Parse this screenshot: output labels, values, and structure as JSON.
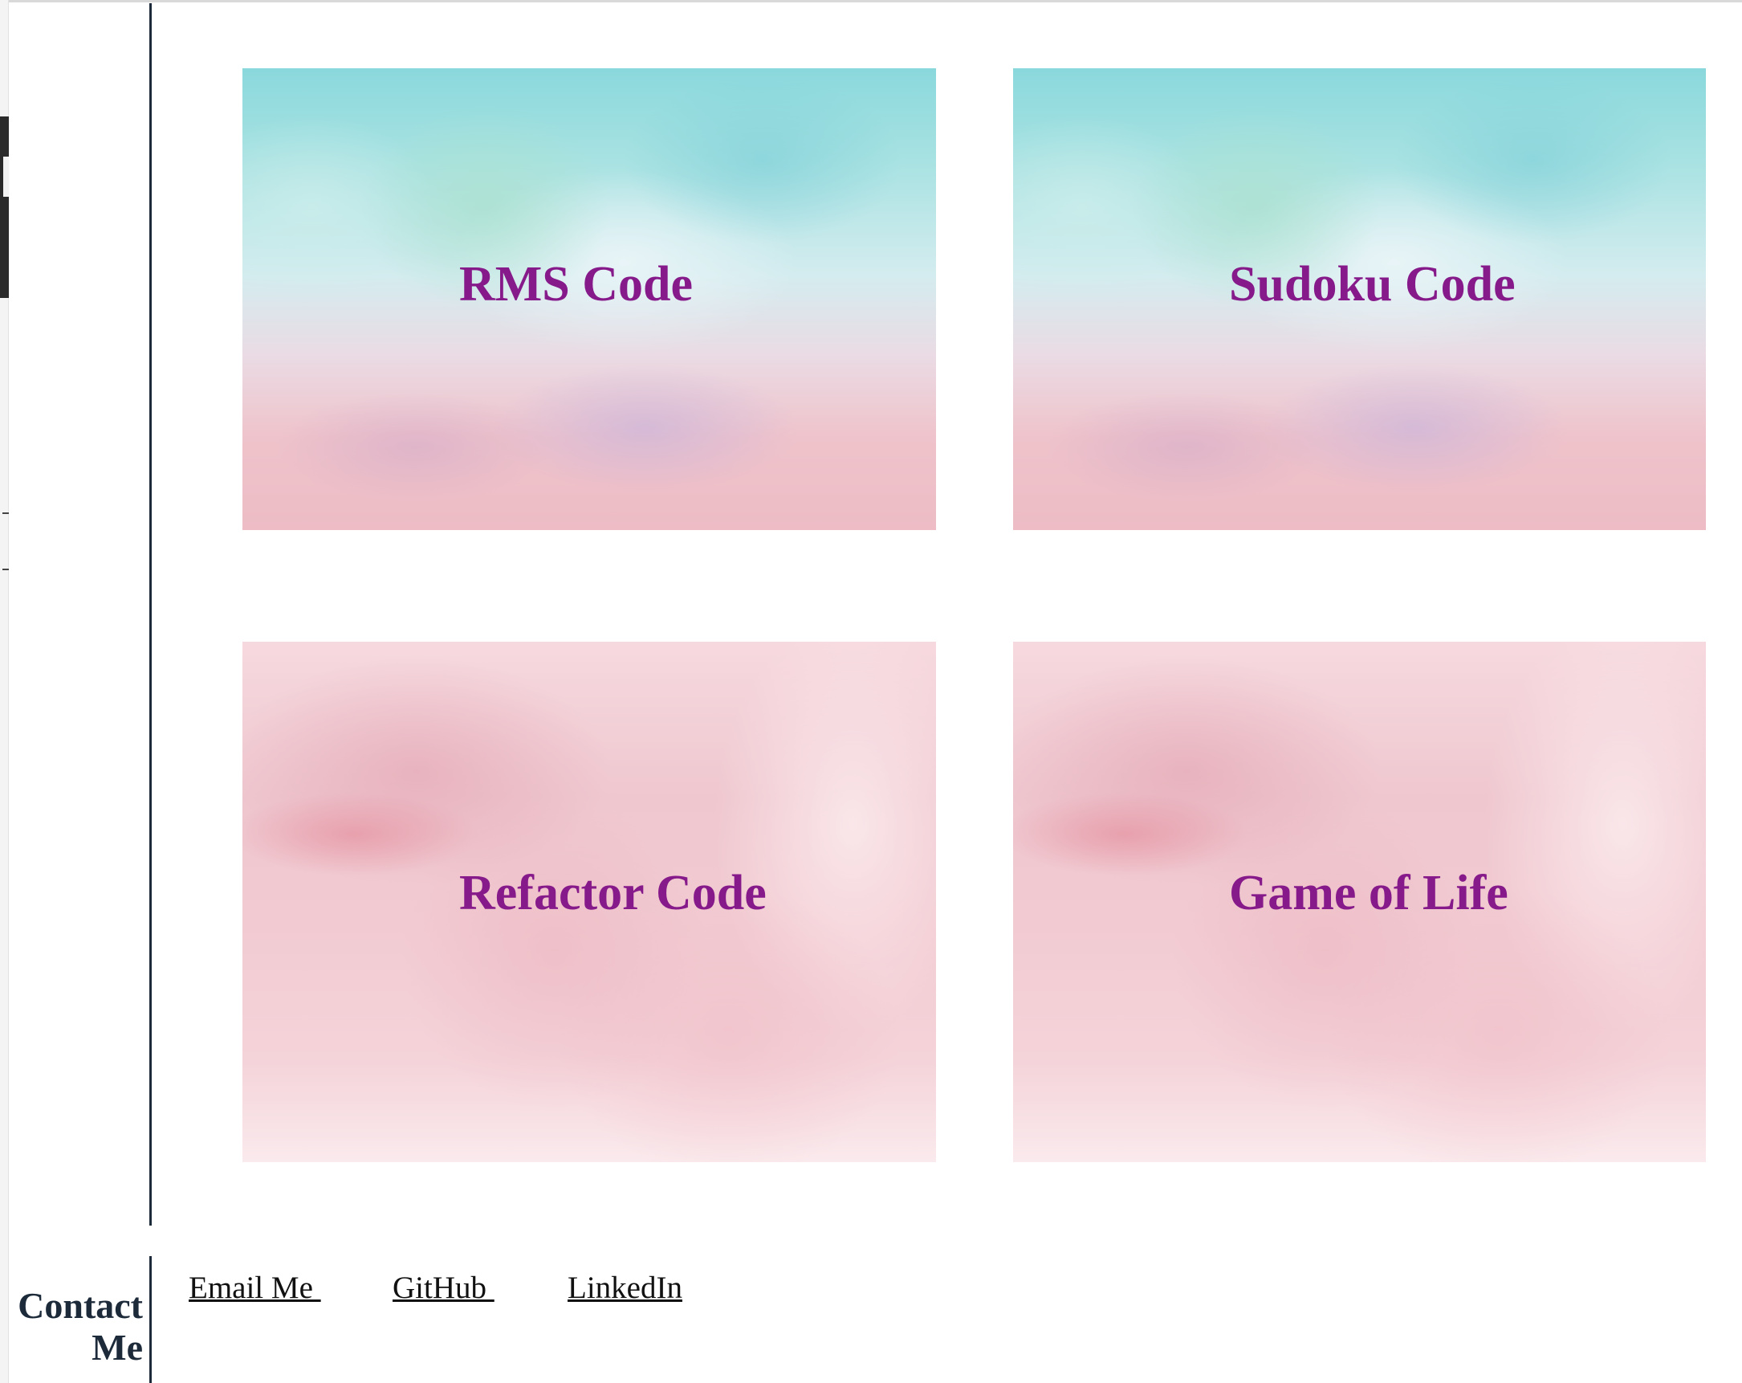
{
  "projects": [
    {
      "label": "RMS Code",
      "theme": "sky"
    },
    {
      "label": "Sudoku Code",
      "theme": "sky"
    },
    {
      "label": "Refactor Code",
      "theme": "pink"
    },
    {
      "label": "Game of Life",
      "theme": "pink"
    }
  ],
  "footer": {
    "heading_line1": "Contact",
    "heading_line2": "Me",
    "links": [
      {
        "label": "Email Me "
      },
      {
        "label": "GitHub "
      },
      {
        "label": "LinkedIn"
      }
    ]
  },
  "colors": {
    "label_text": "#861a8a",
    "divider": "#1c2a3a",
    "link_text": "#111111"
  }
}
